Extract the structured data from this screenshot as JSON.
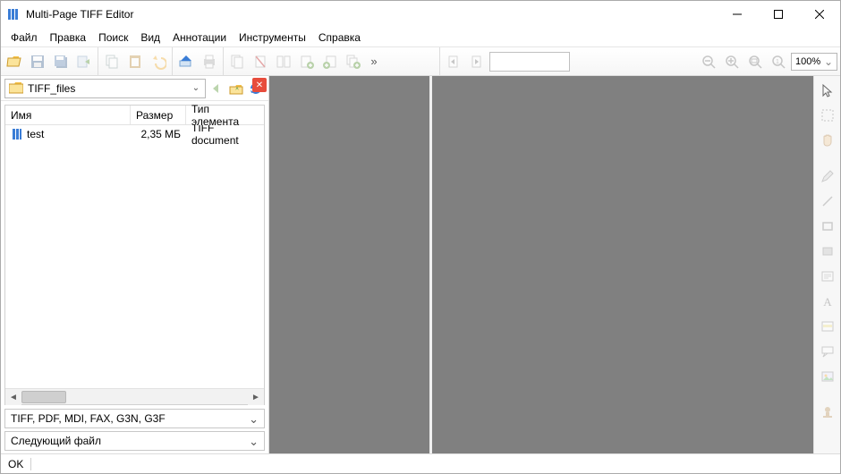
{
  "window": {
    "title": "Multi-Page TIFF Editor"
  },
  "menu": [
    "Файл",
    "Правка",
    "Поиск",
    "Вид",
    "Аннотации",
    "Инструменты",
    "Справка"
  ],
  "path": {
    "folder": "TIFF_files"
  },
  "filelist": {
    "cols": {
      "name": "Имя",
      "size": "Размер",
      "type": "Тип элемента"
    },
    "rows": [
      {
        "name": "test",
        "size": "2,35 МБ",
        "type": "TIFF document"
      }
    ]
  },
  "filterDropdown": "TIFF, PDF, MDI, FAX, G3N, G3F",
  "nextFileDropdown": "Следующий файл",
  "zoom": "100%",
  "status": {
    "ok": "OK"
  },
  "colors": {
    "canvas": "#808080"
  }
}
